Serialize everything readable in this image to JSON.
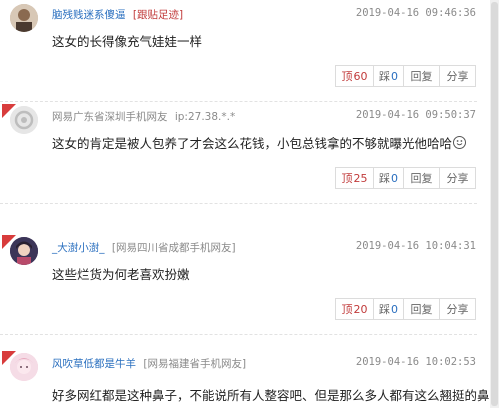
{
  "comments": [
    {
      "name": "脑残贱迷系傻逼",
      "loc": "[跟贴足迹]",
      "time": "2019-04-16 09:46:36",
      "text": "这女的长得像充气娃娃一样",
      "up_label": "顶",
      "up": "60",
      "down_label": "踩",
      "down": "0",
      "reply": "回复",
      "share": "分享",
      "hot": false,
      "avatar_color": "#c9b8a8"
    },
    {
      "name": "网易广东省深圳手机网友",
      "loc": "ip:27.38.*.*",
      "time": "2019-04-16 09:50:37",
      "text": "这女的肯定是被人包养了才会这么花钱，小包总钱拿的不够就曝光他哈哈",
      "up_label": "顶",
      "up": "25",
      "down_label": "踩",
      "down": "0",
      "reply": "回复",
      "share": "分享",
      "hot": true,
      "avatar_color": "#e4e4e4"
    },
    {
      "name": "_大澍小澍_",
      "loc": "[网易四川省成都手机网友]",
      "time": "2019-04-16 10:04:31",
      "text": "这些烂货为何老喜欢扮嫩",
      "up_label": "顶",
      "up": "20",
      "down_label": "踩",
      "down": "0",
      "reply": "回复",
      "share": "分享",
      "hot": true,
      "avatar_color": "#5a4a7a"
    },
    {
      "name": "风吹草低都是牛羊",
      "loc": "[网易福建省手机网友]",
      "time": "2019-04-16 10:02:53",
      "text": "好多网红都是这种鼻子，不能说所有人整容吧、但是那么多人都有这么翘挺的鼻子吗",
      "hot": true,
      "avatar_color": "#f2c6d6"
    }
  ]
}
